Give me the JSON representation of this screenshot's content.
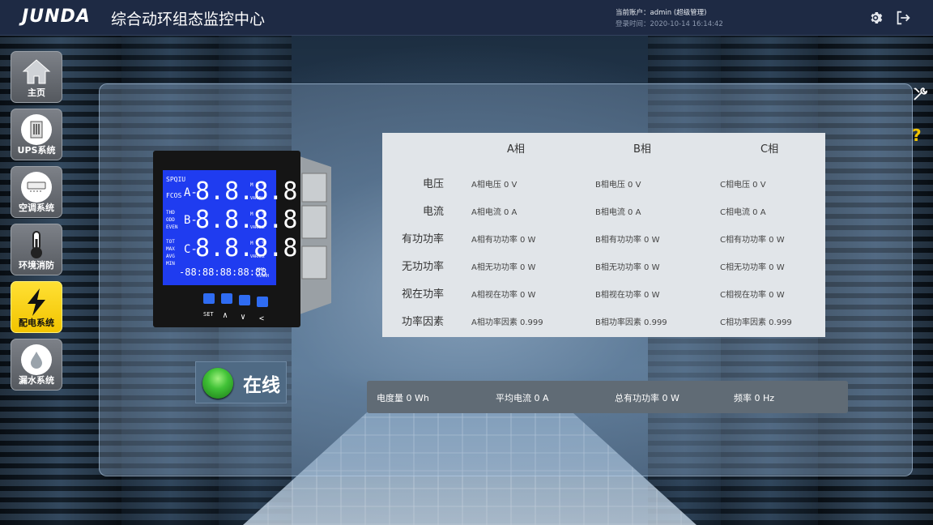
{
  "header": {
    "logo_text": "JUNDA",
    "title": "综合动环组态监控中心",
    "account": "当前账户：admin (超级管理)",
    "login_time": "登录时间：2020-10-14 16:14:42",
    "settings_icon": "gear-icon",
    "logout_icon": "logout-icon"
  },
  "sidebar": {
    "items": [
      {
        "label": "主页",
        "icon": "home-icon",
        "active": false
      },
      {
        "label": "UPS系统",
        "icon": "ups-icon",
        "active": false
      },
      {
        "label": "空调系统",
        "icon": "air-conditioner-icon",
        "active": false
      },
      {
        "label": "环境消防",
        "icon": "thermometer-icon",
        "active": false
      },
      {
        "label": "配电系统",
        "icon": "lightning-icon",
        "active": true
      },
      {
        "label": "漏水系统",
        "icon": "water-drop-icon",
        "active": false
      }
    ]
  },
  "meter": {
    "row_labels_left": [
      "SPQIU",
      "FCOS",
      "THD",
      "ODD",
      "EVEN",
      "TOT",
      "MAX",
      "AVG",
      "MIN"
    ],
    "phase_a": "A-",
    "phase_b": "B-",
    "phase_c": "C-",
    "digits": "8.8.8.8",
    "bottom_digits": "-88:88:88:88:88",
    "units_top": "M K %",
    "units_mid": "VARMHz",
    "units_bottom_1": "KWH",
    "units_bottom_2": "KVARH",
    "set_label": "SET",
    "nav_up": "∧",
    "nav_down": "∨",
    "nav_left": "<"
  },
  "table": {
    "headers": [
      "A相",
      "B相",
      "C相"
    ],
    "rows": [
      {
        "label": "电压",
        "a": "A相电压 0 V",
        "b": "B相电压 0 V",
        "c": "C相电压 0 V"
      },
      {
        "label": "电流",
        "a": "A相电流 0 A",
        "b": "B相电流 0 A",
        "c": "C相电流 0 A"
      },
      {
        "label": "有功功率",
        "a": "A相有功功率 0 W",
        "b": "B相有功功率 0 W",
        "c": "C相有功功率 0 W"
      },
      {
        "label": "无功功率",
        "a": "A相无功功率 0 W",
        "b": "B相无功功率 0 W",
        "c": "C相无功功率 0 W"
      },
      {
        "label": "视在功率",
        "a": "A相视在功率 0 W",
        "b": "B相视在功率 0 W",
        "c": "C相视在功率 0 W"
      },
      {
        "label": "功率因素",
        "a": "A相功率因素 0.999",
        "b": "B相功率因素 0.999",
        "c": "C相功率因素 0.999"
      }
    ]
  },
  "status": {
    "label": "在线",
    "color": "#41c237"
  },
  "summary": {
    "energy": "电度量 0 Wh",
    "avg_current": "平均电流 0 A",
    "total_active_power": "总有功功率 0 W",
    "frequency": "频率 0 Hz"
  },
  "side_tools": {
    "tools_icon": "tools-icon",
    "help_label": "?"
  },
  "colors": {
    "header_bg": "#1e2a44",
    "active_nav": "#f2c400",
    "lcd_bg": "#1f3cf0"
  }
}
